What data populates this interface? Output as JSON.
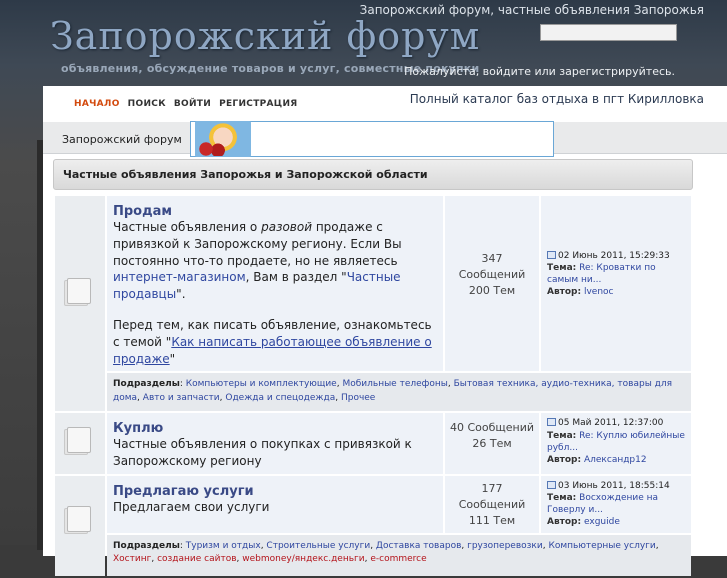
{
  "site": {
    "tagline_top": "Запорожский форум, частные объявления Запорожья",
    "logo_title": "Запорожский форум",
    "logo_subtitle": "объявления, обсуждение товаров и услуг, совместные покупки",
    "login_prompt": "Пожалуйста, войдите или зарегистрируйтесь."
  },
  "nav": {
    "items": [
      {
        "label": "НАЧАЛО"
      },
      {
        "label": "ПОИСК"
      },
      {
        "label": "ВОЙТИ"
      },
      {
        "label": "РЕГИСТРАЦИЯ"
      }
    ],
    "active_color": "#d34a0e"
  },
  "promo": {
    "text": "Полный каталог баз отдыха в пгт Кирилловка"
  },
  "breadcrumb": {
    "label": "Запорожский форум"
  },
  "category": {
    "title": "Частные объявления Запорожья и Запорожской области"
  },
  "forums": [
    {
      "name": "Продам",
      "desc_parts": {
        "p1_a": "Частные объявления о ",
        "p1_ital": "разовой",
        "p1_b": " продаже с привязкой к Запорожскому региону. Если Вы постоянно что-то продаете, но не являетесь ",
        "p1_link": "интернет-магазином",
        "p1_c": ", Вам в раздел \"",
        "p1_link2": "Частные продавцы",
        "p1_d": "\".",
        "p2_a": "Перед тем, как писать объявление, ознакомьтесь с темой \"",
        "p2_link": "Как написать работающее объявление о продаже",
        "p2_b": "\""
      },
      "stats": {
        "posts": "347",
        "posts_label": "Сообщений",
        "topics": "200 Тем"
      },
      "last": {
        "date": "02 Июнь 2011, 15:29:33",
        "topic_label": "Тема:",
        "topic": "Re: Кроватки по самым ни...",
        "author_label": "Автор:",
        "author": "lvenoc"
      },
      "subforums": {
        "label": "Подразделы",
        "items": [
          "Компьютеры и комплектующие",
          "Мобильные телефоны",
          "Бытовая техника, аудио-техника, товары для дома",
          "Авто и запчасти",
          "Одежда и спецодежда",
          "Прочее"
        ]
      }
    },
    {
      "name": "Куплю",
      "desc": "Частные объявления о покупках с привязкой к Запорожскому региону",
      "stats": {
        "posts_line": "40 Сообщений",
        "topics": "26 Тем"
      },
      "last": {
        "date": "05 Май 2011, 12:37:00",
        "topic_label": "Тема:",
        "topic": "Re: Куплю юбилейные рубл...",
        "author_label": "Автор:",
        "author": "Александр12"
      }
    },
    {
      "name": "Предлагаю услуги",
      "desc": "Предлагаем свои услуги",
      "stats": {
        "posts": "177",
        "posts_label": "Сообщений",
        "topics": "111 Тем"
      },
      "last": {
        "date": "03 Июнь 2011, 18:55:14",
        "topic_label": "Тема:",
        "topic": "Восхождение на Говерлу и...",
        "author_label": "Автор:",
        "author": "exguide"
      },
      "subforums": {
        "label": "Подразделы",
        "items": [
          "Туризм и отдых",
          "Строительные услуги",
          "Доставка товаров",
          "грузоперевозки",
          "Компьютерные услуги"
        ],
        "red_items": [
          "Хостинг",
          "создание сайтов",
          "webmoney/яндекс.деньги",
          "e-commerce"
        ]
      }
    }
  ]
}
